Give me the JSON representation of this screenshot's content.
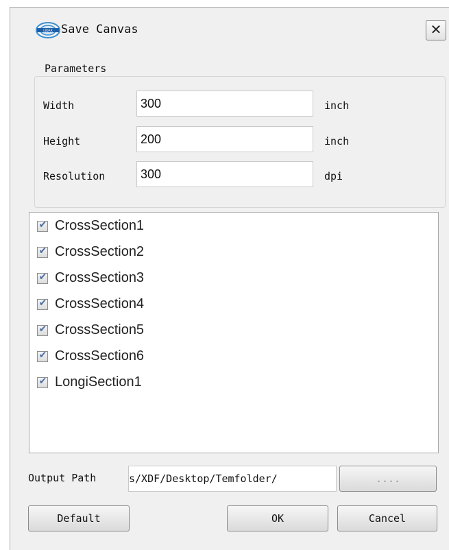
{
  "dialog": {
    "title": "Save Canvas",
    "close_label": "✕",
    "logo_icon": "app-logo-icon"
  },
  "parameters": {
    "group_title": "Parameters",
    "fields": [
      {
        "label": "Width",
        "value": "300",
        "unit": "inch"
      },
      {
        "label": "Height",
        "value": "200",
        "unit": "inch"
      },
      {
        "label": "Resolution",
        "value": "300",
        "unit": "dpi"
      }
    ]
  },
  "sections": {
    "items": [
      {
        "label": "CrossSection1",
        "checked": true
      },
      {
        "label": "CrossSection2",
        "checked": true
      },
      {
        "label": "CrossSection3",
        "checked": true
      },
      {
        "label": "CrossSection4",
        "checked": true
      },
      {
        "label": "CrossSection5",
        "checked": true
      },
      {
        "label": "CrossSection6",
        "checked": true
      },
      {
        "label": "LongiSection1",
        "checked": true
      }
    ],
    "check_glyph": "✔"
  },
  "output": {
    "label": "Output Path",
    "value": "s/XDF/Desktop/Temfolder/",
    "browse_label": "...."
  },
  "buttons": {
    "default_label": "Default",
    "ok_label": "OK",
    "cancel_label": "Cancel"
  },
  "colors": {
    "dialog_bg": "#f0f0f0",
    "check_tick": "#4a6ea9",
    "border": "#a8a8a8"
  }
}
